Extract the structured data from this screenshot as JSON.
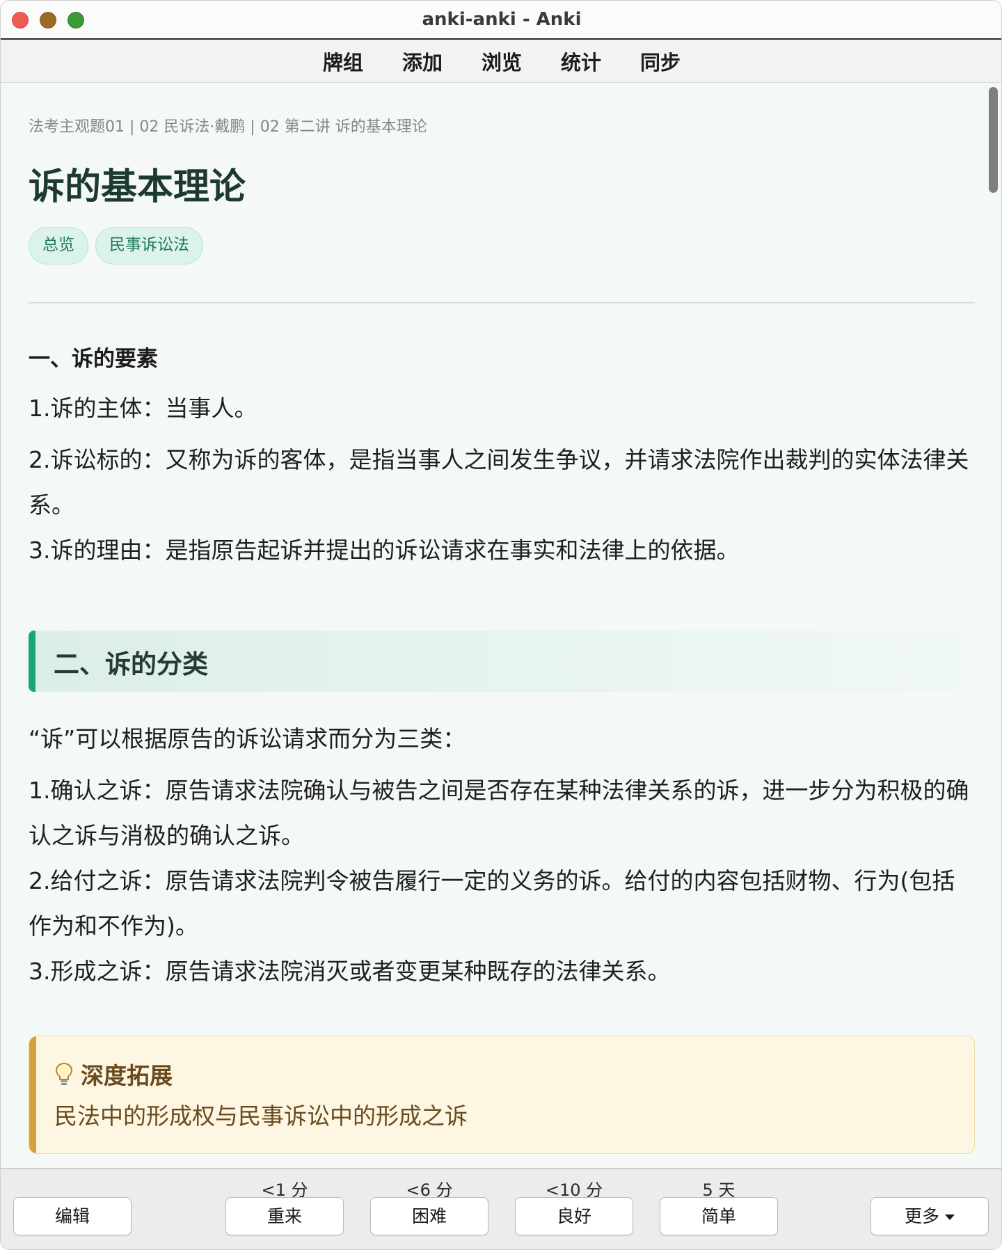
{
  "window": {
    "title": "anki-anki - Anki"
  },
  "topnav": {
    "items": [
      "牌组",
      "添加",
      "浏览",
      "统计",
      "同步"
    ]
  },
  "card": {
    "breadcrumb": "法考主观题01 | 02 民诉法·戴鹏 | 02 第二讲 诉的基本理论",
    "title": "诉的基本理论",
    "tags": [
      "总览",
      "民事诉讼法"
    ],
    "section1": {
      "heading": "一、诉的要素",
      "items": [
        "1.诉的主体：当事人。",
        "2.诉讼标的：又称为诉的客体，是指当事人之间发生争议，并请求法院作出裁判的实体法律关系。",
        "3.诉的理由：是指原告起诉并提出的诉讼请求在事实和法律上的依据。"
      ]
    },
    "section2": {
      "heading": "二、诉的分类",
      "intro": "“诉”可以根据原告的诉讼请求而分为三类：",
      "items": [
        "1.确认之诉：原告请求法院确认与被告之间是否存在某种法律关系的诉，进一步分为积极的确认之诉与消极的确认之诉。",
        "2.给付之诉：原告请求法院判令被告履行一定的义务的诉。给付的内容包括财物、行为(包括作为和不作为)。",
        "3.形成之诉：原告请求法院消灭或者变更某种既存的法律关系。"
      ]
    },
    "callout": {
      "icon": "lightbulb-icon",
      "title": "深度拓展",
      "body": "民法中的形成权与民事诉讼中的形成之诉"
    }
  },
  "bottom": {
    "edit_label": "编辑",
    "more_label": "更多",
    "answers": [
      {
        "interval": "<1 分",
        "label": "重来"
      },
      {
        "interval": "<6 分",
        "label": "困难"
      },
      {
        "interval": "<10 分",
        "label": "良好"
      },
      {
        "interval": "5 天",
        "label": "简单"
      }
    ]
  },
  "colors": {
    "accent_green": "#18a57a",
    "tag_bg": "#dcf3ea",
    "callout_bar": "#d4a23a",
    "callout_bg": "#fdf6e3"
  }
}
